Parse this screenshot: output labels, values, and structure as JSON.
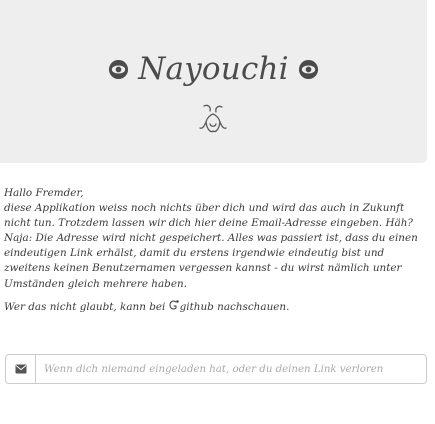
{
  "header": {
    "brand": "Nayouchi"
  },
  "intro": {
    "greeting": "Hallo Fremder,",
    "body": "diese Applikation weiss noch nichts über dich und wird das auch in Zukunft nicht tun. Trotzdem lassen wir dich hier deine Email-Adresse eingeben. Häh? Naja: Die Adresse wird nicht gespeichert. Alles was passiert ist, dass du einen eindeutigen Link erhälst, damit du erstens irgendwie eindeutig bist und zweitens keinen Benutzernamen vergessen kannst - du wirst nämlich unter Umständen gleich mehrere haben.",
    "github_prefix": "Wer das nicht glaubt, kann bei ",
    "github_link": "github",
    "github_suffix": " nachschauen."
  },
  "link_form": {
    "placeholder": "Wenn dich niemand eingeladen hat, oder du deinen Link verloren",
    "value": ""
  },
  "icons": {
    "brand_left": "eye-icon",
    "brand_right": "eye-icon",
    "logo": "moustache-icon",
    "github": "github-icon",
    "input_addon": "envelope-icon"
  },
  "colors": {
    "hero_background": "#eeeeee",
    "text": "#3a3a3a",
    "border": "#cccccc"
  }
}
